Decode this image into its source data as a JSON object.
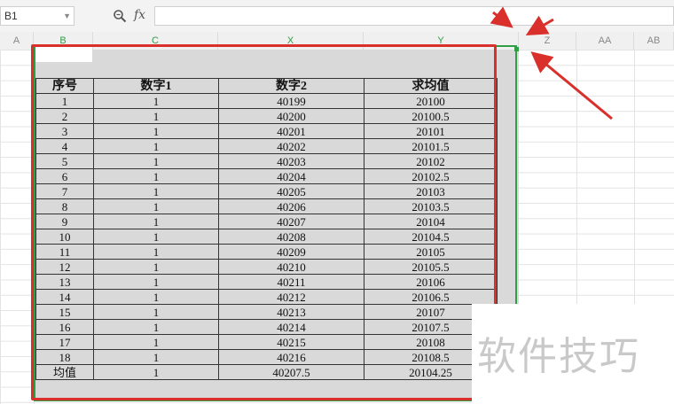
{
  "formula_bar": {
    "cell_reference": "B1",
    "fx_label": "fx",
    "formula": ""
  },
  "columns": [
    "A",
    "B",
    "C",
    "X",
    "Y",
    "Z",
    "AA",
    "AB"
  ],
  "table": {
    "headers": [
      "序号",
      "数字1",
      "数字2",
      "求均值"
    ],
    "rows": [
      [
        "1",
        "1",
        "40199",
        "20100"
      ],
      [
        "2",
        "1",
        "40200",
        "20100.5"
      ],
      [
        "3",
        "1",
        "40201",
        "20101"
      ],
      [
        "4",
        "1",
        "40202",
        "20101.5"
      ],
      [
        "5",
        "1",
        "40203",
        "20102"
      ],
      [
        "6",
        "1",
        "40204",
        "20102.5"
      ],
      [
        "7",
        "1",
        "40205",
        "20103"
      ],
      [
        "8",
        "1",
        "40206",
        "20103.5"
      ],
      [
        "9",
        "1",
        "40207",
        "20104"
      ],
      [
        "10",
        "1",
        "40208",
        "20104.5"
      ],
      [
        "11",
        "1",
        "40209",
        "20105"
      ],
      [
        "12",
        "1",
        "40210",
        "20105.5"
      ],
      [
        "13",
        "1",
        "40211",
        "20106"
      ],
      [
        "14",
        "1",
        "40212",
        "20106.5"
      ],
      [
        "15",
        "1",
        "40213",
        "20107"
      ],
      [
        "16",
        "1",
        "40214",
        "20107.5"
      ],
      [
        "17",
        "1",
        "40215",
        "20108"
      ],
      [
        "18",
        "1",
        "40216",
        "20108.5"
      ]
    ],
    "footer": [
      "均值",
      "1",
      "40207.5",
      "20104.25"
    ]
  },
  "watermark": "软件技巧",
  "colors": {
    "selection_green": "#2f9e44",
    "annotation_red": "#d9302c",
    "selection_gray": "#d9d9d9"
  }
}
